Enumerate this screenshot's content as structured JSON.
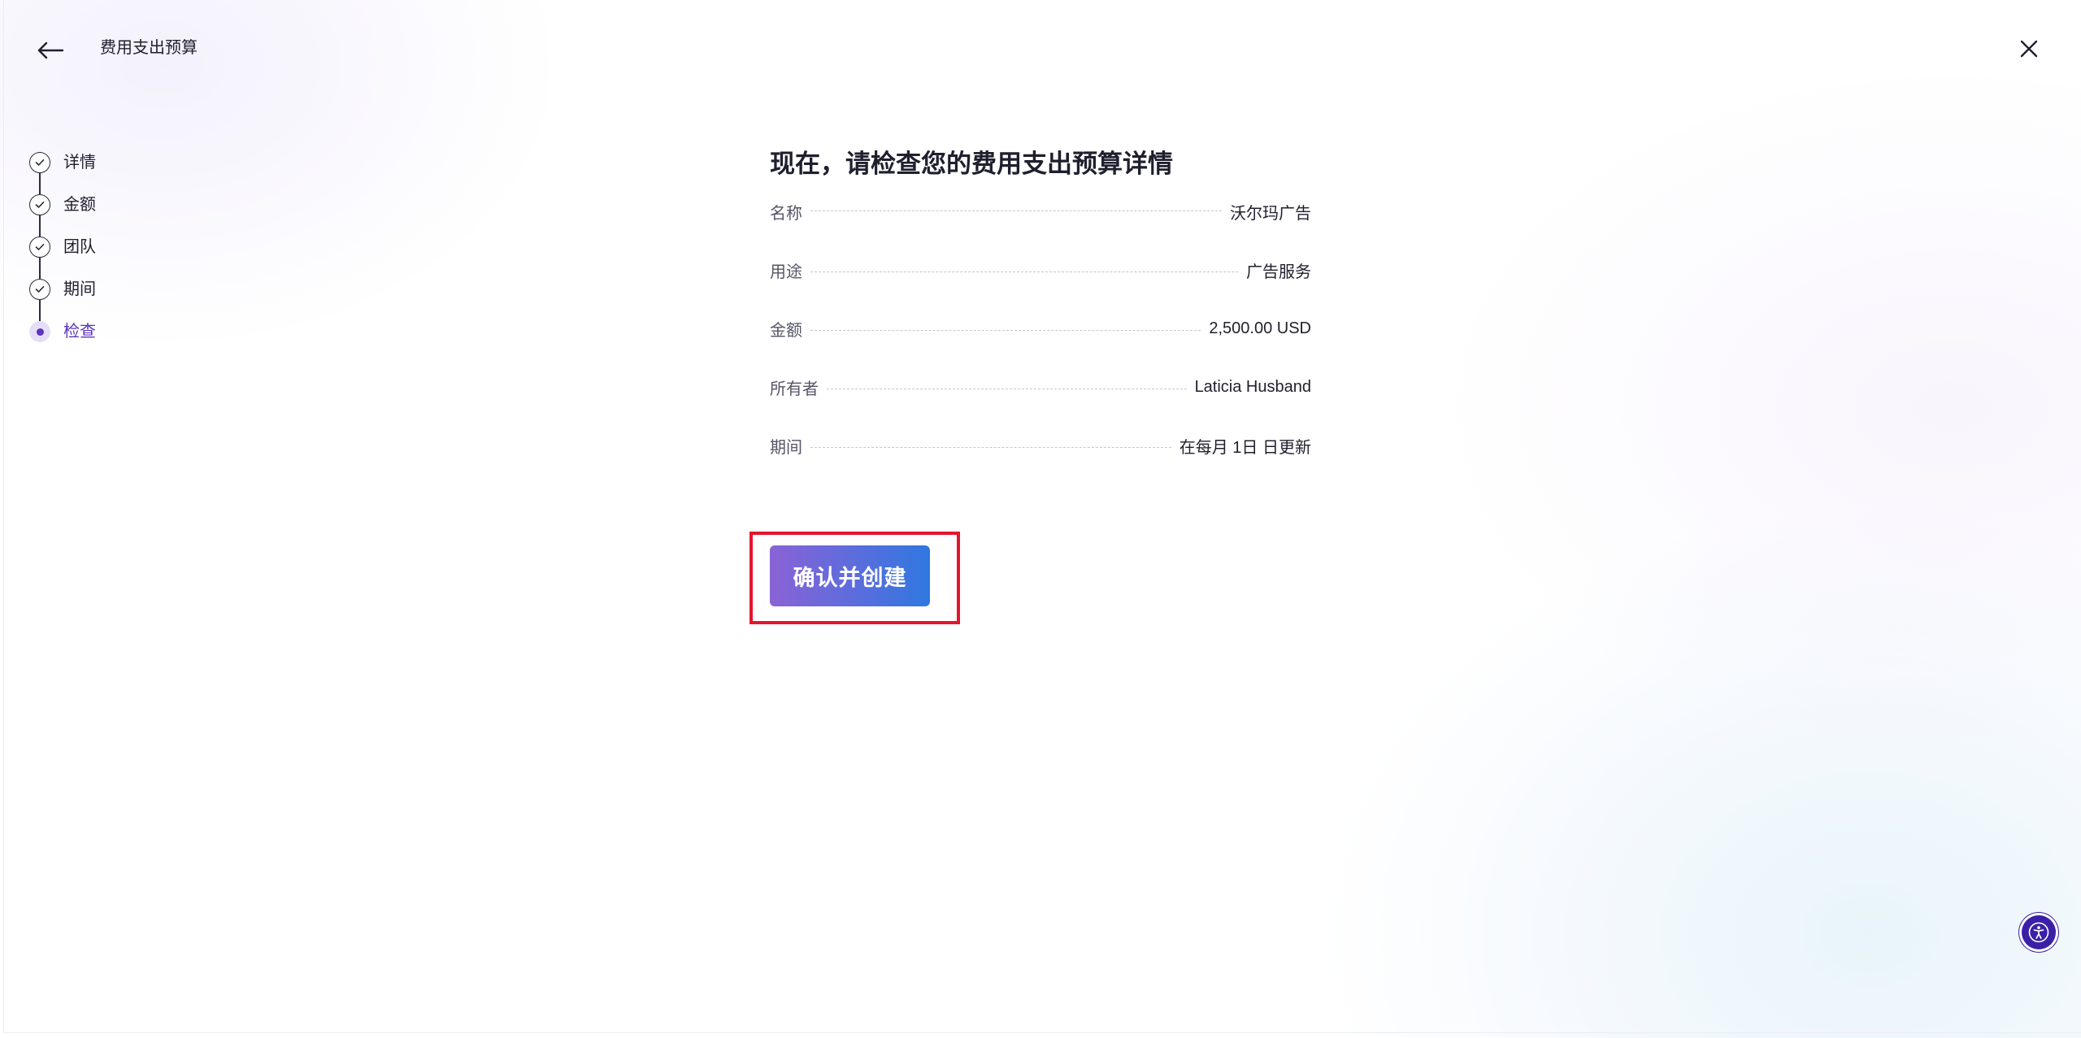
{
  "header": {
    "title": "费用支出预算",
    "back_icon": "arrow-left-icon",
    "close_icon": "close-icon"
  },
  "stepper": {
    "steps": [
      {
        "label": "详情",
        "state": "done"
      },
      {
        "label": "金额",
        "state": "done"
      },
      {
        "label": "团队",
        "state": "done"
      },
      {
        "label": "期间",
        "state": "done"
      },
      {
        "label": "检查",
        "state": "current"
      }
    ]
  },
  "main": {
    "title": "现在，请检查您的费用支出预算详情",
    "rows": [
      {
        "label": "名称",
        "value": "沃尔玛广告"
      },
      {
        "label": "用途",
        "value": "广告服务"
      },
      {
        "label": "金额",
        "value": "2,500.00 USD"
      },
      {
        "label": "所有者",
        "value": "Laticia Husband"
      },
      {
        "label": "期间",
        "value": "在每月 1日 日更新"
      }
    ],
    "confirm_label": "确认并创建"
  },
  "accessibility": {
    "icon": "accessibility-icon"
  },
  "colors": {
    "accent": "#5a36b8",
    "button_gradient_start": "#8a63d6",
    "button_gradient_end": "#2f78e0",
    "highlight_border": "#e5142d",
    "a11y_button": "#3b1fa8"
  }
}
